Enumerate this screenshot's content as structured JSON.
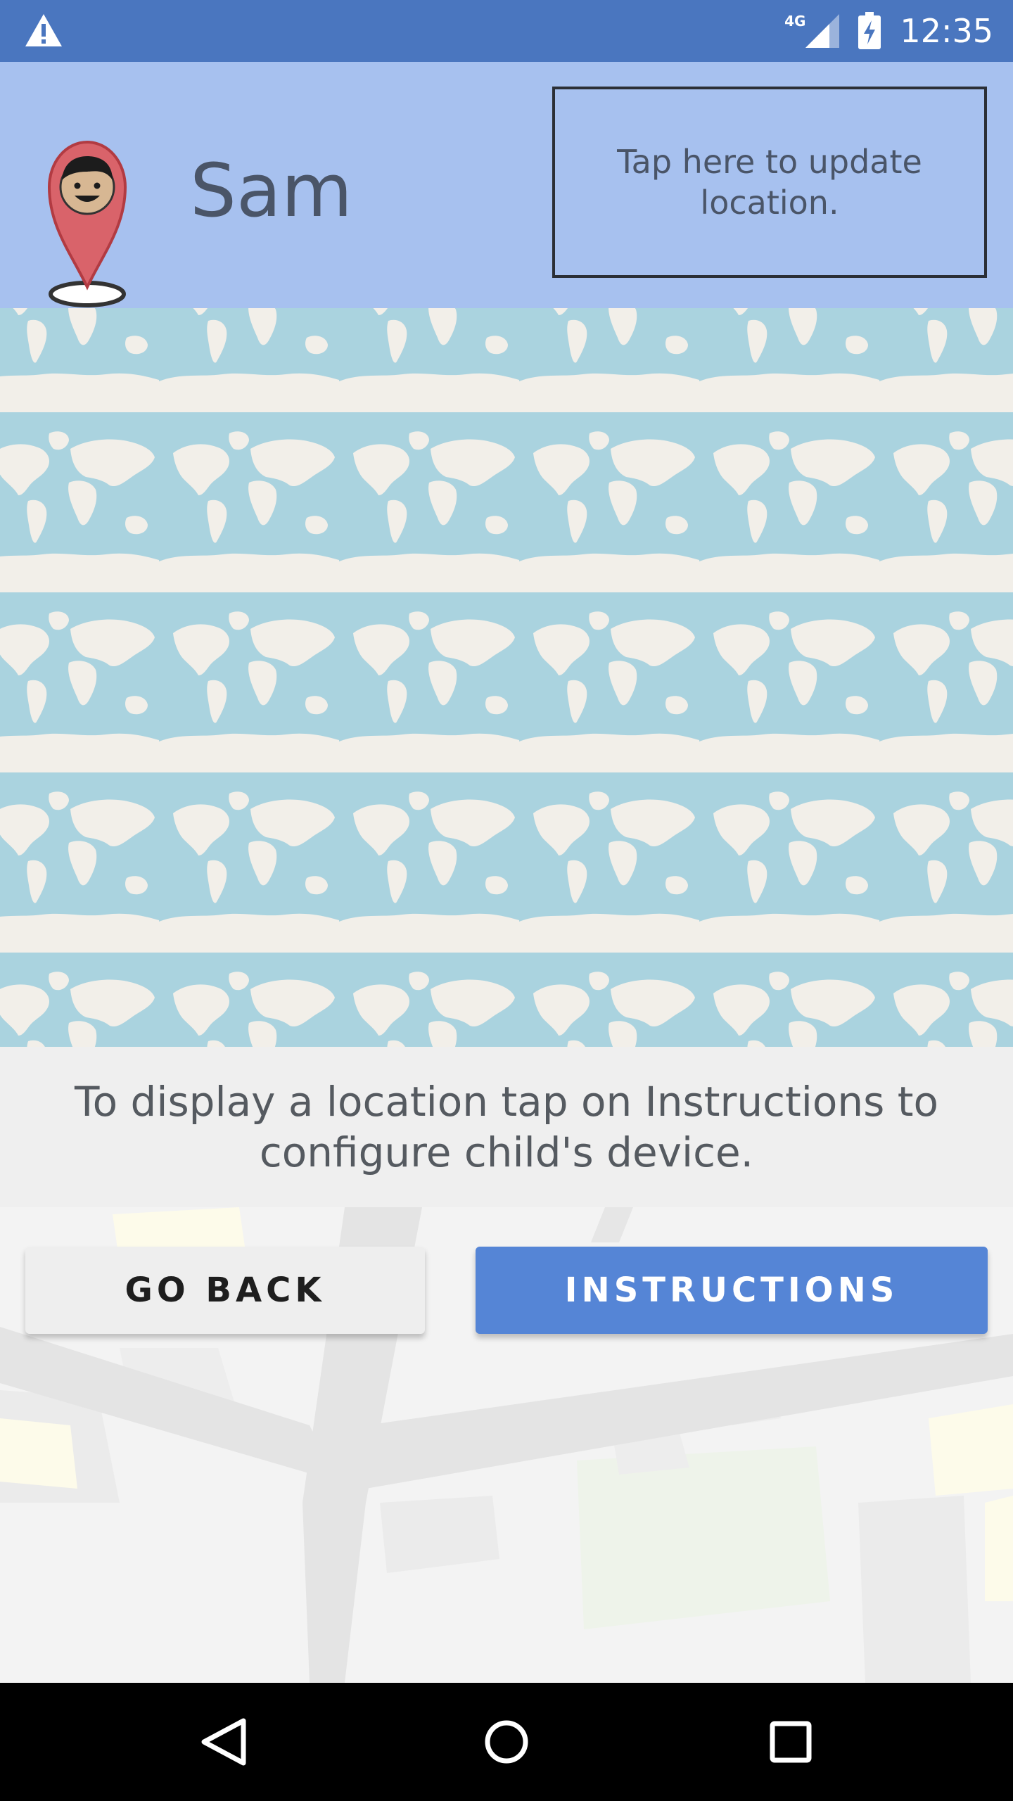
{
  "status_bar": {
    "network_type": "4G",
    "time": "12:35",
    "icons": [
      "warning-icon",
      "signal-icon",
      "battery-charging-icon"
    ]
  },
  "header": {
    "child_name": "Sam",
    "update_location_label": "Tap here to update location.",
    "avatar": "map-pin-avatar-icon"
  },
  "message": {
    "text": "To display a location tap on Instructions to configure child's device."
  },
  "buttons": {
    "go_back_label": "GO BACK",
    "instructions_label": "INSTRUCTIONS"
  },
  "nav_bar": {
    "icons": [
      "back-triangle-icon",
      "home-circle-icon",
      "recents-square-icon"
    ]
  },
  "colors": {
    "status_bar": "#4a76bf",
    "header": "#a7c1ef",
    "ocean": "#aad3df",
    "land": "#f2efe9",
    "primary_button": "#5585d6"
  }
}
